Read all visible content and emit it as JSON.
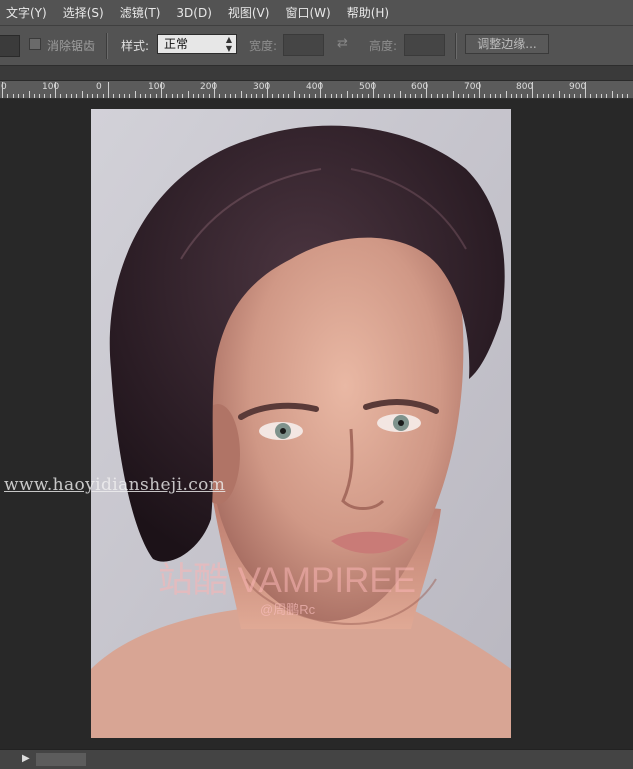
{
  "menubar": {
    "items": [
      {
        "label": "文字(Y)"
      },
      {
        "label": "选择(S)"
      },
      {
        "label": "滤镜(T)"
      },
      {
        "label": "3D(D)"
      },
      {
        "label": "视图(V)"
      },
      {
        "label": "窗口(W)"
      },
      {
        "label": "帮助(H)"
      }
    ]
  },
  "options": {
    "antialias_label": "消除锯齿",
    "antialias_checked": false,
    "style_label": "样式:",
    "style_value": "正常",
    "width_label": "宽度:",
    "width_value": "",
    "height_label": "高度:",
    "height_value": "",
    "refine_label": "调整边缘..."
  },
  "ruler": {
    "labels": [
      "0",
      "100",
      "0",
      "100",
      "200",
      "300",
      "400",
      "500",
      "600",
      "700",
      "800",
      "900"
    ]
  },
  "canvas": {
    "watermark_url": "www.haoyidiansheji.com",
    "watermark_title": "站酷 VAMPIREE",
    "watermark_author": "@周鹏Rc"
  },
  "colors": {
    "menubar_bg": "#535353",
    "workspace_bg": "#282828",
    "photo_bg": "#c9c8cf",
    "hair": "#2b1d25",
    "skin": "#d39a88"
  }
}
